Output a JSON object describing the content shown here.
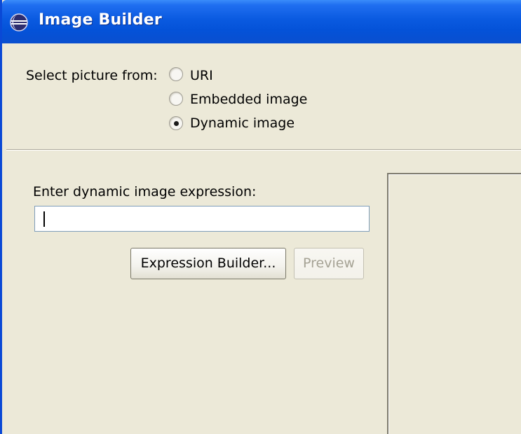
{
  "window": {
    "title": "Image Builder",
    "icon": "eclipse-icon"
  },
  "source": {
    "label": "Select picture from:",
    "options": [
      {
        "label": "URI",
        "selected": false
      },
      {
        "label": "Embedded image",
        "selected": false
      },
      {
        "label": "Dynamic image",
        "selected": true
      }
    ]
  },
  "expression": {
    "label": "Enter dynamic image expression:",
    "value": ""
  },
  "buttons": {
    "expression_builder": "Expression Builder...",
    "preview": "Preview"
  },
  "colors": {
    "title_bar": "#0a5ae0",
    "dialog_background": "#ece9d8"
  }
}
